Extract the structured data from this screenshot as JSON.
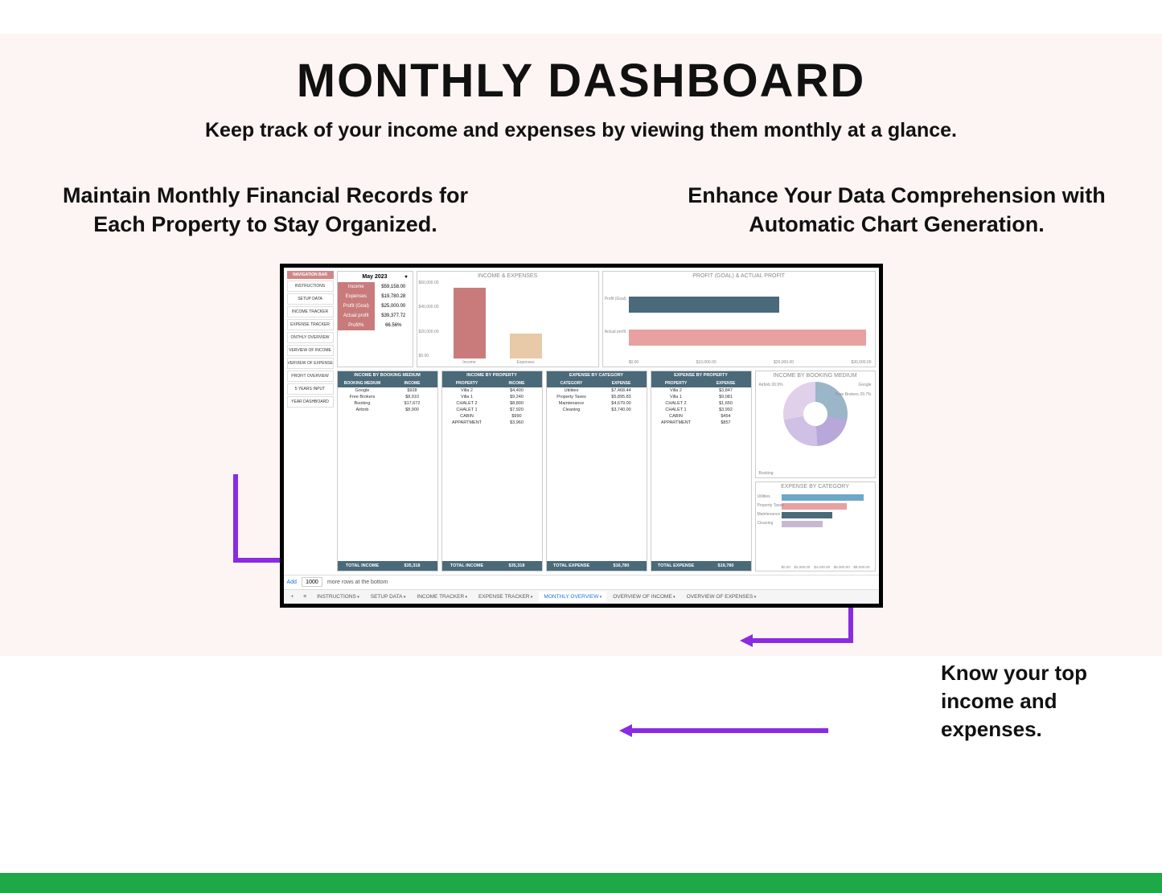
{
  "hero": {
    "title": "MONTHLY DASHBOARD",
    "subtitle": "Keep track of your income and expenses by viewing them monthly at a glance."
  },
  "callouts": {
    "c1": "Maintain Monthly Financial Records for Each Property to Stay Organized.",
    "c2": "Enhance Your Data Comprehension with Automatic Chart Generation.",
    "c3": "Know your top income and expenses."
  },
  "nav": {
    "header": "NAVIGATION BAR",
    "items": [
      "INSTRUCTIONS",
      "SETUP DATA",
      "INCOME TRACKER",
      "EXPENSE TRACKER",
      "ONTHLY OVERVIEW",
      "VERVIEW OF INCOME",
      "VERVIEW OF EXPENSE",
      "PROFIT OVERVIEW",
      "5 YEARS INPUT",
      "YEAR DASHBOARD"
    ]
  },
  "month": {
    "label": "May 2023",
    "rows": [
      {
        "label": "Income",
        "value": "$59,158.00"
      },
      {
        "label": "Expenses",
        "value": "$19,780.28"
      },
      {
        "label": "Profit (Goal)",
        "value": "$25,000.00"
      },
      {
        "label": "Actual profit",
        "value": "$39,377.72"
      },
      {
        "label": "Profit%",
        "value": "66.56%"
      }
    ]
  },
  "charts": {
    "ie": {
      "title": "INCOME & EXPENSES",
      "yticks": [
        "$60,000.00",
        "$40,000.00",
        "$20,000.00",
        "$0.00"
      ],
      "income_label": "Income",
      "expenses_label": "Expenses"
    },
    "profit": {
      "title": "PROFIT (GOAL) & ACTUAL PROFIT",
      "goal_label": "Profit (Goal)",
      "actual_label": "Actual profit",
      "xticks": [
        "$0.00",
        "$10,000.00",
        "$20,000.00",
        "$30,000.00"
      ]
    },
    "donut": {
      "title": "INCOME BY BOOKING MEDIUM",
      "labels": {
        "airbnb": "Airbnb 30.9%",
        "google": "Google",
        "fb": "Free Brokers 29.7%",
        "booking": "Booking"
      }
    },
    "expcat": {
      "title": "EXPENSE BY CATEGORY",
      "labels": [
        "Utilities",
        "Property Taxes",
        "Maintenance",
        "Cleaning"
      ],
      "xticks": [
        "$0.00",
        "$2,000.00",
        "$4,000.00",
        "$6,000.00",
        "$8,000.00"
      ]
    }
  },
  "chart_data": [
    {
      "type": "bar",
      "title": "INCOME & EXPENSES",
      "categories": [
        "Income",
        "Expenses"
      ],
      "values": [
        59158,
        19780
      ],
      "ylim": [
        0,
        60000
      ]
    },
    {
      "type": "bar",
      "orientation": "horizontal",
      "title": "PROFIT (GOAL) & ACTUAL PROFIT",
      "categories": [
        "Profit (Goal)",
        "Actual profit"
      ],
      "values": [
        25000,
        39378
      ],
      "xlim": [
        0,
        40000
      ]
    },
    {
      "type": "pie",
      "title": "INCOME BY BOOKING MEDIUM",
      "categories": [
        "Airbnb",
        "Google",
        "Free Brokers",
        "Booking"
      ],
      "values": [
        30.9,
        20,
        29.7,
        19.4
      ]
    },
    {
      "type": "bar",
      "orientation": "horizontal",
      "title": "EXPENSE BY CATEGORY",
      "categories": [
        "Utilities",
        "Property Taxes",
        "Maintenance",
        "Cleaning"
      ],
      "values": [
        7468,
        5896,
        4679,
        3740
      ],
      "xlim": [
        0,
        8000
      ]
    }
  ],
  "tables": {
    "t1": {
      "title": "INCOME BY BOOKING MEDIUM",
      "cols": [
        "BOOKING MEDIUM",
        "INCOME"
      ],
      "rows": [
        [
          "Google",
          "$928"
        ],
        [
          "Free Brokers",
          "$8,910"
        ],
        [
          "Booking",
          "$17,672"
        ],
        [
          "Airbnb",
          "$8,900"
        ]
      ],
      "footer": [
        "TOTAL INCOME",
        "$35,318"
      ]
    },
    "t2": {
      "title": "INCOME BY PROPERTY",
      "cols": [
        "PROPERTY",
        "INCOME"
      ],
      "rows": [
        [
          "Villa 2",
          "$4,400"
        ],
        [
          "Villa 1",
          "$9,240"
        ],
        [
          "CHALET 2",
          "$8,800"
        ],
        [
          "CHALET 1",
          "$7,920"
        ],
        [
          "CABIN",
          "$990"
        ],
        [
          "APPARTMENT",
          "$3,960"
        ]
      ],
      "footer": [
        "TOTAL INCOME",
        "$35,318"
      ]
    },
    "t3": {
      "title": "EXPENSE BY CATEGORY",
      "cols": [
        "CATEGORY",
        "EXPENSE"
      ],
      "rows": [
        [
          "Utilities",
          "$7,468.44"
        ],
        [
          "Property Taxes",
          "$5,895.83"
        ],
        [
          "Maintenance",
          "$4,679.00"
        ],
        [
          "Cleaning",
          "$3,740.00"
        ]
      ],
      "footer": [
        "TOTAL EXPENSE",
        "$16,780"
      ]
    },
    "t4": {
      "title": "EXPENSE BY PROPERTY",
      "cols": [
        "PROPERTY",
        "EXPENSE"
      ],
      "rows": [
        [
          "Villa 2",
          "$3,847"
        ],
        [
          "Villa 1",
          "$9,081"
        ],
        [
          "CHALET 2",
          "$1,650"
        ],
        [
          "CHALET 1",
          "$3,992"
        ],
        [
          "CABIN",
          "$454"
        ],
        [
          "APPARTMENT",
          "$857"
        ]
      ],
      "footer": [
        "TOTAL EXPENSE",
        "$19,780"
      ]
    }
  },
  "footer": {
    "add": "Add",
    "rows": "1000",
    "txt": "more rows at the bottom"
  },
  "tabs": [
    "INSTRUCTIONS",
    "SETUP DATA",
    "INCOME TRACKER",
    "EXPENSE TRACKER",
    "MONTHLY OVERVIEW",
    "OVERVIEW OF INCOME",
    "OVERVIEW OF EXPENSES"
  ]
}
